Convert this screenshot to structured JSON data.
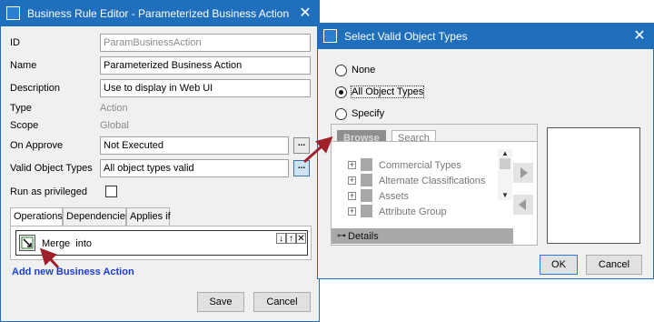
{
  "editor": {
    "title": "Business Rule Editor - Parameterized Business Action",
    "fields": {
      "id_label": "ID",
      "id_value": "ParamBusinessAction",
      "name_label": "Name",
      "name_value": "Parameterized Business Action",
      "description_label": "Description",
      "description_value": "Use to display in Web UI",
      "type_label": "Type",
      "type_value": "Action",
      "scope_label": "Scope",
      "scope_value": "Global",
      "on_approve_label": "On Approve",
      "on_approve_value": "Not Executed",
      "valid_object_types_label": "Valid Object Types",
      "valid_object_types_value": "All object types valid",
      "run_as_privileged_label": "Run as privileged",
      "run_as_privileged_checked": false
    },
    "tabs": [
      "Operations",
      "Dependencies",
      "Applies if"
    ],
    "selected_tab": "Operations",
    "operation": {
      "label": "Merge  into"
    },
    "add_link": "Add new Business Action",
    "buttons": {
      "save": "Save",
      "cancel": "Cancel"
    }
  },
  "dialog": {
    "title": "Select Valid Object Types",
    "options": [
      "None",
      "All Object Types",
      "Specify"
    ],
    "selected_option": "All Object Types",
    "tabs": {
      "browse": "Browse",
      "search": "Search"
    },
    "tree_items": [
      "Commercial Types",
      "Alternate Classifications",
      "Assets",
      "Attribute Group"
    ],
    "details_label": "Details",
    "buttons": {
      "ok": "OK",
      "cancel": "Cancel"
    }
  },
  "colors": {
    "title_bar": "#1f6fbd",
    "link": "#1a3fd4",
    "callout_arrow": "#a0202a"
  },
  "icons": [
    "close-icon",
    "dialog-window-icon",
    "ellipsis-icon",
    "merge-operation-icon",
    "arrow-down-icon",
    "arrow-up-icon",
    "remove-icon",
    "tree-expand-icon",
    "move-right-icon",
    "move-left-icon",
    "details-icon"
  ]
}
